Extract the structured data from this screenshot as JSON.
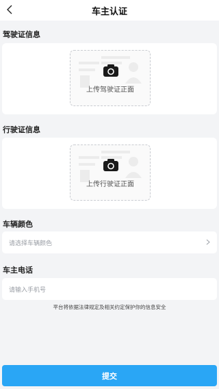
{
  "nav": {
    "title": "车主认证",
    "back_icon": "chevron-left-icon"
  },
  "license": {
    "section_title": "驾驶证信息",
    "upload_label": "上传驾驶证正面",
    "icon": "camera-icon"
  },
  "registration": {
    "section_title": "行驶证信息",
    "upload_label": "上传行驶证正面",
    "icon": "camera-icon"
  },
  "color": {
    "section_title": "车辆颜色",
    "placeholder": "请选择车辆颜色",
    "icon": "chevron-right-icon"
  },
  "phone": {
    "section_title": "车主电话",
    "placeholder": "请输入手机号"
  },
  "notice": "平台将依据法律规定及相关约定保护你的信息安全",
  "submit_label": "提交",
  "colors": {
    "accent": "#2aa6f5",
    "background": "#f3f4f6"
  }
}
